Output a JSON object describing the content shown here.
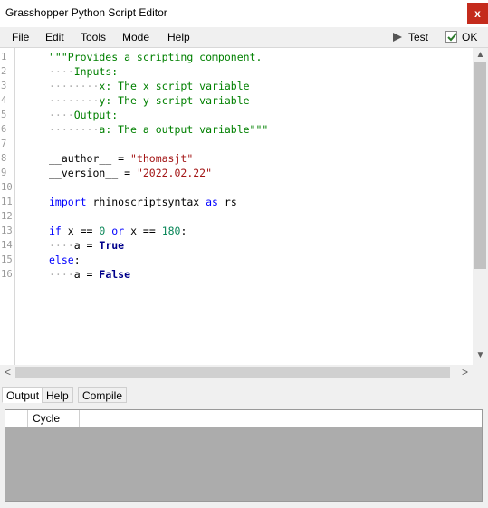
{
  "window": {
    "title": "Grasshopper Python Script Editor",
    "close_glyph": "x",
    "close_color": "#c42b1c"
  },
  "menu": {
    "items": [
      "File",
      "Edit",
      "Tools",
      "Mode",
      "Help"
    ],
    "test_label": "Test",
    "ok_label": "OK"
  },
  "editor": {
    "line_numbers": [
      "1",
      "2",
      "3",
      "4",
      "5",
      "6",
      "7",
      "8",
      "9",
      "10",
      "11",
      "12",
      "13",
      "14",
      "15",
      "16"
    ],
    "lines": {
      "l1": "\"\"\"Provides a scripting component.",
      "l2_dots": "····",
      "l2_text": "Inputs:",
      "l3_dots": "········",
      "l3_text": "x: The x script variable",
      "l4_dots": "········",
      "l4_text": "y: The y script variable",
      "l5_dots": "····",
      "l5_text": "Output:",
      "l6_dots": "········",
      "l6_text": "a: The a output variable\"\"\"",
      "l8_ident": "__author__ = ",
      "l8_str": "\"thomasjt\"",
      "l9_ident": "__version__ = ",
      "l9_str": "\"2022.02.22\"",
      "l11_kw1": "import",
      "l11_mid": " rhinoscriptsyntax ",
      "l11_kw2": "as",
      "l11_end": " rs",
      "l13_kw1": "if",
      "l13_a": " x == ",
      "l13_n1": "0",
      "l13_sp": " ",
      "l13_kw2": "or",
      "l13_b": " x == ",
      "l13_n2": "180",
      "l13_c": ":",
      "l14_dots": "····",
      "l14_a": "a = ",
      "l14_kw": "True",
      "l15_kw": "else",
      "l15_c": ":",
      "l16_dots": "····",
      "l16_a": "a = ",
      "l16_kw": "False"
    },
    "colors": {
      "docstring": "#008000",
      "keyword": "#0000ff",
      "string": "#a31515",
      "number": "#098658"
    }
  },
  "scroll": {
    "up_glyph": "▲",
    "down_glyph": "▼",
    "left_glyph": "<",
    "right_glyph": ">"
  },
  "bottom": {
    "tabs": [
      "Output",
      "Help",
      "Compile"
    ],
    "active_tab": "Output",
    "columns": [
      "Cycle"
    ]
  }
}
